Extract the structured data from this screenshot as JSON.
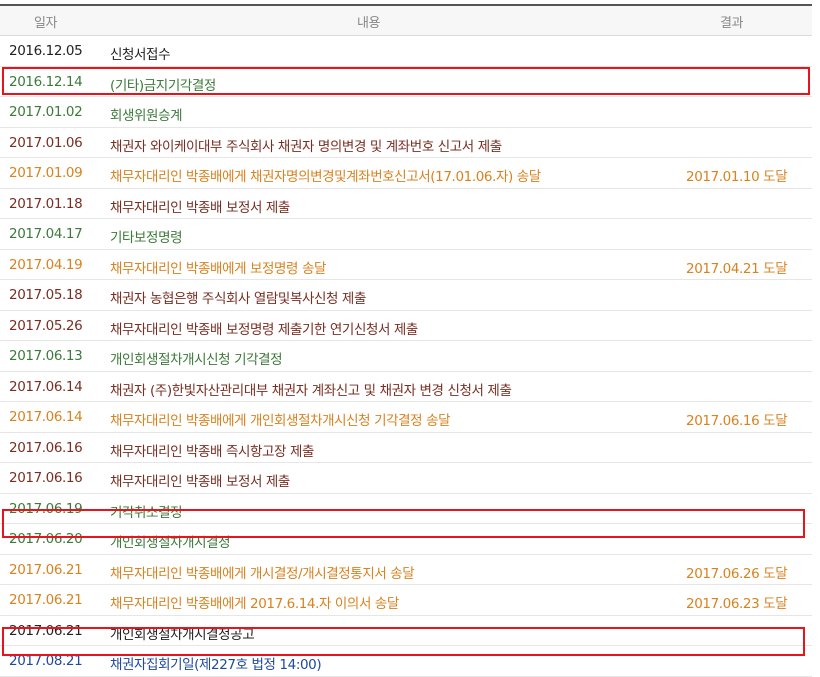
{
  "header": {
    "date": "일자",
    "content": "내용",
    "result": "결과"
  },
  "colors": {
    "black": "#222222",
    "green": "#3c7a3a",
    "brown": "#7a2e22",
    "orange": "#d9821e",
    "blue": "#1f4aa0",
    "highlight": "#e8141b"
  },
  "rows": [
    {
      "date": "2016.12.05",
      "content": "신청서접수",
      "result": "",
      "color": "black"
    },
    {
      "date": "2016.12.14",
      "content": "(기타)금지기각결정",
      "result": "",
      "color": "green",
      "highlighted": true
    },
    {
      "date": "2017.01.02",
      "content": "회생위원승계",
      "result": "",
      "color": "green"
    },
    {
      "date": "2017.01.06",
      "content": "채권자 와이케이대부 주식회사 채권자 명의변경 및 계좌번호 신고서 제출",
      "result": "",
      "color": "brown"
    },
    {
      "date": "2017.01.09",
      "content": "채무자대리인 박종배에게 채권자명의변경및계좌번호신고서(17.01.06.자) 송달",
      "result": "2017.01.10 도달",
      "color": "orange"
    },
    {
      "date": "2017.01.18",
      "content": "채무자대리인 박종배 보정서 제출",
      "result": "",
      "color": "brown"
    },
    {
      "date": "2017.04.17",
      "content": "기타보정명령",
      "result": "",
      "color": "green"
    },
    {
      "date": "2017.04.19",
      "content": "채무자대리인 박종배에게 보정명령 송달",
      "result": "2017.04.21 도달",
      "color": "orange"
    },
    {
      "date": "2017.05.18",
      "content": "채권자 농협은행 주식회사 열람및복사신청 제출",
      "result": "",
      "color": "brown"
    },
    {
      "date": "2017.05.26",
      "content": "채무자대리인 박종배 보정명령 제출기한 연기신청서 제출",
      "result": "",
      "color": "brown"
    },
    {
      "date": "2017.06.13",
      "content": "개인회생절차개시신청 기각결정",
      "result": "",
      "color": "green"
    },
    {
      "date": "2017.06.14",
      "content": "채권자 (주)한빛자산관리대부 채권자 계좌신고 및 채권자 변경 신청서 제출",
      "result": "",
      "color": "brown"
    },
    {
      "date": "2017.06.14",
      "content": "채무자대리인 박종배에게 개인회생절차개시신청 기각결정 송달",
      "result": "2017.06.16 도달",
      "color": "orange"
    },
    {
      "date": "2017.06.16",
      "content": "채무자대리인 박종배 즉시항고장 제출",
      "result": "",
      "color": "brown"
    },
    {
      "date": "2017.06.16",
      "content": "채무자대리인 박종배 보정서 제출",
      "result": "",
      "color": "brown"
    },
    {
      "date": "2017.06.19",
      "content": "기각취소결정",
      "result": "",
      "color": "green"
    },
    {
      "date": "2017.06.20",
      "content": "개인회생절차개시결정",
      "result": "",
      "color": "green",
      "highlighted": true
    },
    {
      "date": "2017.06.21",
      "content": "채무자대리인 박종배에게 개시결정/개시결정통지서 송달",
      "result": "2017.06.26 도달",
      "color": "orange"
    },
    {
      "date": "2017.06.21",
      "content": "채무자대리인 박종배에게 2017.6.14.자 이의서 송달",
      "result": "2017.06.23 도달",
      "color": "orange"
    },
    {
      "date": "2017.06.21",
      "content": "개인회생절차개시결정공고",
      "result": "",
      "color": "black"
    },
    {
      "date": "2017.08.21",
      "content": "채권자집회기일(제227호 법정 14:00)",
      "result": "",
      "color": "blue",
      "highlighted": true
    }
  ]
}
